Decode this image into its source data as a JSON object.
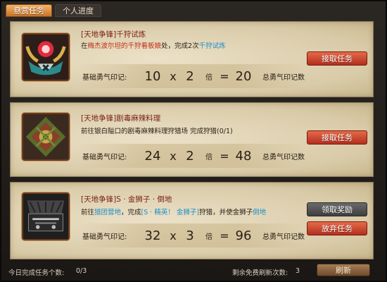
{
  "tabs": [
    {
      "label": "悬赏任务"
    },
    {
      "label": "个人进度"
    }
  ],
  "quests": [
    {
      "title": "[天地争锋]千狩试炼",
      "desc_parts": [
        "在",
        "梅杰波尔坦的千狩看板娘",
        "处，完成2次",
        "千狩试炼"
      ],
      "base_label": "基础勇气印记:",
      "base": "10",
      "times": "x",
      "mult": "2",
      "mult_unit": "倍",
      "eq": "=",
      "total": "20",
      "total_label": "总勇气印记数",
      "buttons": [
        "接取任务"
      ]
    },
    {
      "title": "[天地争锋]剧毒麻辣料理",
      "desc": "前往银白隘口的剧毒麻辣料理狩猎场 完成狩猎(0/1)",
      "base_label": "基础勇气印记:",
      "base": "24",
      "times": "x",
      "mult": "2",
      "mult_unit": "倍",
      "eq": "=",
      "total": "48",
      "total_label": "总勇气印记数",
      "buttons": [
        "接取任务"
      ]
    },
    {
      "title": "[天地争锋]S · 金狮子 · 倒地",
      "desc_parts": [
        "前往",
        "猎团营地",
        "，完成",
        "[S · 精英！ 金狮子]",
        "狩猎，并使金狮子",
        "倒地"
      ],
      "base_label": "基础勇气印记:",
      "base": "32",
      "times": "x",
      "mult": "3",
      "mult_unit": "倍",
      "eq": "=",
      "total": "96",
      "total_label": "总勇气印记数",
      "buttons": [
        "领取奖励",
        "放弃任务"
      ]
    }
  ],
  "footer": {
    "completed_label": "今日完成任务个数:",
    "completed_value": "0/3",
    "refresh_remaining_label": "剩余免费刷新次数:",
    "refresh_remaining_value": "3",
    "refresh_button": "刷新"
  },
  "colors": {
    "accent_red": "#c42b18",
    "accent_blue": "#1c8fc9",
    "title_red": "#7b1f14"
  }
}
